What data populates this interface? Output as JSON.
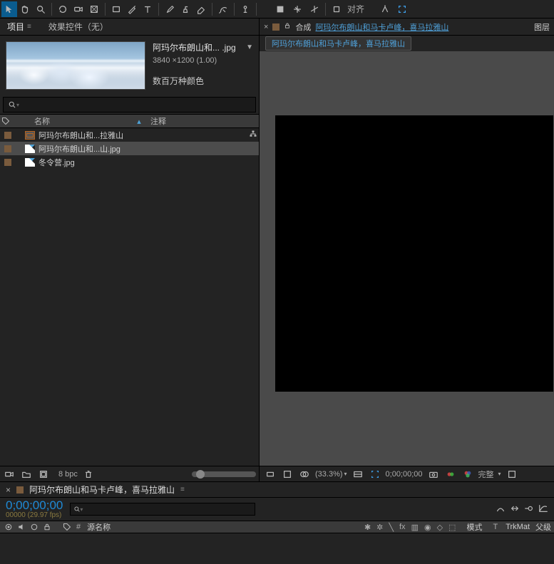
{
  "toolbar": {
    "align_label": "对齐"
  },
  "project": {
    "tab_project": "项目",
    "tab_effects": "效果控件（无）",
    "asset": {
      "title": "阿玛尔布朗山和... .jpg",
      "dimensions": "3840 ×1200 (1.00)",
      "colors": "数百万种颜色"
    },
    "columns": {
      "name": "名称",
      "comment": "注释"
    },
    "rows": [
      {
        "type": "comp",
        "name": "阿玛尔布朗山和...拉雅山",
        "flow": true
      },
      {
        "type": "image",
        "name": "阿玛尔布朗山和...山.jpg",
        "selected": true
      },
      {
        "type": "image",
        "name": "冬令营.jpg"
      }
    ],
    "footer": {
      "bpc": "8 bpc"
    }
  },
  "composition": {
    "tab_label": "合成",
    "link_name": "阿玛尔布朗山和马卡卢峰，喜马拉雅山",
    "layers_tab": "图层",
    "breadcrumb": "阿玛尔布朗山和马卡卢峰，喜马拉雅山"
  },
  "viewer_footer": {
    "zoom": "(33.3%)",
    "timecode": "0;00;00;00",
    "quality": "完整"
  },
  "timeline": {
    "tab_title": "阿玛尔布朗山和马卡卢峰，喜马拉雅山",
    "timecode": "0;00;00;00",
    "frames": "00000 (29.97 fps)",
    "header": {
      "hash": "#",
      "source_name": "源名称",
      "mode": "模式",
      "t": "T",
      "trkmat": "TrkMat",
      "parent": "父级"
    }
  }
}
